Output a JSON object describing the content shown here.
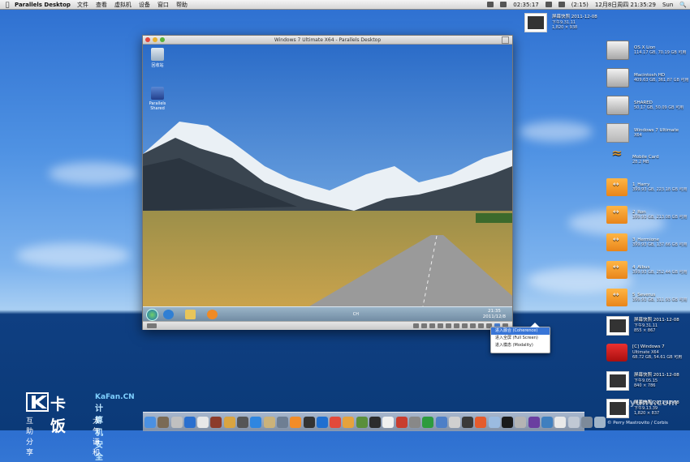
{
  "menubar": {
    "app_name": "Parallels Desktop",
    "menus": [
      "文件",
      "查看",
      "虚拟机",
      "设备",
      "窗口",
      "帮助"
    ],
    "tray": {
      "time_remaining": "02:35:17",
      "input_method": "(2:15)",
      "date_time": "12月8日周四  21:35:29",
      "user": "Sun"
    }
  },
  "vm_window": {
    "title": "Windows 7 Ultimate X64 - Parallels Desktop",
    "guest_icons": [
      {
        "label": "回收站"
      },
      {
        "label": "Parallels Shared"
      }
    ],
    "taskbar": {
      "clock_time": "21:35",
      "clock_date": "2011/12/8",
      "lang": "CH"
    }
  },
  "view_popup": {
    "options": [
      {
        "label": "进入融合 (Coherence)",
        "selected": true
      },
      {
        "label": "进入全屏 (Full Screen)",
        "selected": false
      },
      {
        "label": "进入模态 (Modality)",
        "selected": false
      }
    ]
  },
  "desktop_icons": [
    {
      "name": "屏幕快照 2011-12-08",
      "line2": "下午9.31.11",
      "line3": "1,820 × 938",
      "kind": "screenshot"
    },
    {
      "name": "OS X Lion",
      "line2": "114.17 GB, 70.19 GB 可用",
      "kind": "hdd"
    },
    {
      "name": "Macintosh HD",
      "line2": "409.63 GB, 361.87 GB 可用",
      "kind": "hdd"
    },
    {
      "name": "SHARED",
      "line2": "50.17 GB, 50.09 GB 可用",
      "kind": "hdd"
    },
    {
      "name": "Windows 7 Ultimate",
      "line2": "X64",
      "kind": "parallels"
    },
    {
      "name": "Mobile Card",
      "line2": "28.2 MB",
      "kind": "wifi"
    },
    {
      "name": "1_Harry",
      "line2": "399.93 GB, 223.18 GB 可用",
      "kind": "usb"
    },
    {
      "name": "2_Ron",
      "line2": "399.93 GB, 213.08 GB 可用",
      "kind": "usb"
    },
    {
      "name": "3_Hermione",
      "line2": "399.93 GB, 137.66 GB 可用",
      "kind": "usb"
    },
    {
      "name": "4_Albus",
      "line2": "399.93 GB, 252.44 GB 可用",
      "kind": "usb"
    },
    {
      "name": "5_Severus",
      "line2": "399.93 GB, 311.93 GB 可用",
      "kind": "usb"
    },
    {
      "name": "屏幕快照 2011-12-08",
      "line2": "下午9.31.11",
      "line3": "855 × 867",
      "kind": "screenshot"
    },
    {
      "name": "[C] Windows 7",
      "line2": "Ultimate X64",
      "line3": "68.72 GB, 54.61 GB 可用",
      "kind": "parallels-red"
    },
    {
      "name": "屏幕快照 2011-12-08",
      "line2": "下午9.05.15",
      "line3": "840 × 786",
      "kind": "screenshot"
    },
    {
      "name": "屏幕快照 2011-12-08",
      "line2": "下午9.13.39",
      "line3": "1,820 × 837",
      "kind": "screenshot"
    }
  ],
  "dock_colors": [
    "#4a90e2",
    "#7a6a55",
    "#c0c0c0",
    "#2a6fcf",
    "#e8e8e8",
    "#8c3b2a",
    "#d9a441",
    "#555",
    "#2f86e0",
    "#cbb27a",
    "#6e7e93",
    "#f28c28",
    "#333",
    "#1f6fd0",
    "#e24a3b",
    "#e6a23c",
    "#5a8f3a",
    "#2c2c2c",
    "#f0f0f0",
    "#c83d2f",
    "#888",
    "#2d9b3e",
    "#4d7fc7",
    "#d0d0d0",
    "#3a3a3a",
    "#e45b2d",
    "#9bbbe0",
    "#1a1a1a",
    "#b4b4b4",
    "#6a3fa0",
    "#3f7fbf",
    "#e9e9e9",
    "#c0c8d4",
    "#7d8a9a",
    "#a0b4c8"
  ],
  "watermark": {
    "brand": "卡饭",
    "site": "KaFan.CN",
    "slogan": "计算机安全",
    "tagline_left": "互助分享",
    "tagline_right": "大气谦和",
    "credit": "© Perry Mastrovito / Corbis",
    "lyunv": "lyunv.com"
  }
}
